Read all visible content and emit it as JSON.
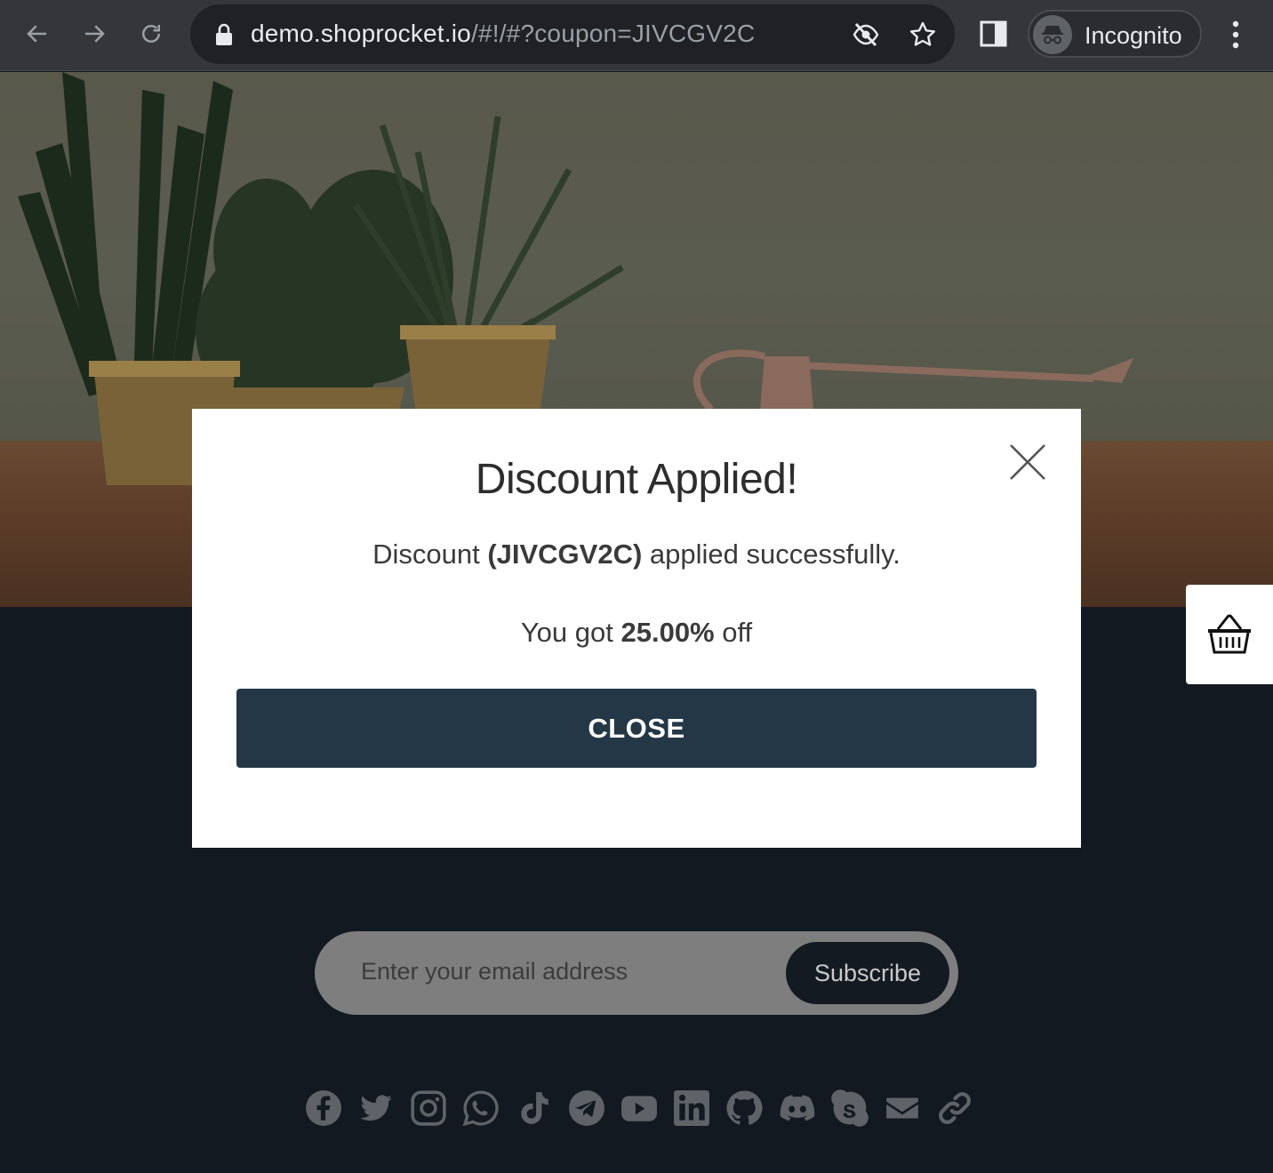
{
  "browser": {
    "url_host": "demo.shoprocket.io",
    "url_path": "/#!/#?coupon=JIVCGV2C",
    "incognito_label": "Incognito"
  },
  "modal": {
    "title": "Discount Applied!",
    "line1_prefix": "Discount ",
    "coupon_code": "(JIVCGV2C)",
    "line1_suffix": " applied successfully.",
    "line2_prefix": "You got ",
    "discount_value": "25.00%",
    "line2_suffix": " off",
    "close_button_label": "CLOSE"
  },
  "newsletter": {
    "placeholder": "Enter your email address",
    "subscribe_label": "Subscribe"
  },
  "socials": [
    "facebook",
    "twitter",
    "instagram",
    "whatsapp",
    "tiktok",
    "telegram",
    "youtube",
    "linkedin",
    "github",
    "discord",
    "skype",
    "email",
    "link"
  ],
  "colors": {
    "modal_button": "#243746",
    "footer": "#131921",
    "chrome": "#35363a"
  }
}
